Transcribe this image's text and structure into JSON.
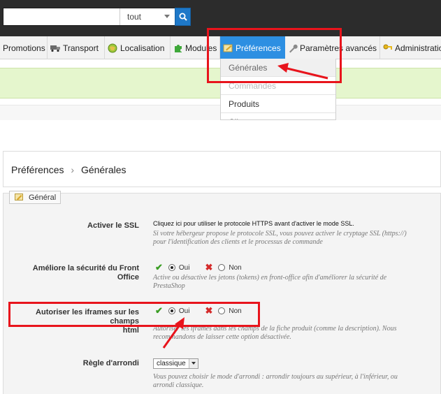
{
  "search": {
    "value": "",
    "scope": "tout"
  },
  "nav": {
    "items": [
      "Promotions",
      "Transport",
      "Localisation",
      "Modules",
      "Préférences",
      "Paramètres avancés",
      "Administration"
    ],
    "active_index": 4
  },
  "dropdown": {
    "items": [
      "Générales",
      "Commandes",
      "Produits",
      "Clients"
    ]
  },
  "breadcrumb": {
    "parent": "Préférences",
    "separator": "›",
    "current": "Générales"
  },
  "fieldset": {
    "legend": "Général"
  },
  "rows": {
    "ssl": {
      "label": "Activer le SSL",
      "link_text": "Cliquez ici pour utiliser le protocole HTTPS avant d'activer le mode SSL.",
      "hint_line1": "Si votre hébergeur propose le protocole SSL, vous pouvez activer le cryptage SSL (https://)",
      "hint_line2": "pour l'identification des clients et le processus de commande"
    },
    "security": {
      "label": "Améliore la sécurité du Front Office",
      "yes": "Oui",
      "no": "Non",
      "hint_line1": "Active ou désactive les jetons (tokens) en front-office afin d'améliorer la sécurité de",
      "hint_line2": "PrestaShop"
    },
    "iframes": {
      "label_line1": "Autoriser les iframes sur les champs",
      "label_line2": "html",
      "yes": "Oui",
      "no": "Non",
      "hint_line1": "Autoriser les iframes dans les champs de la fiche produit (comme la description). Nous",
      "hint_line2": "recommandons de laisser cette option désactivée."
    },
    "rounding": {
      "label": "Règle d'arrondi",
      "value": "classique",
      "hint_line1": "Vous pouvez choisir le mode d'arrondi : arrondir toujours au supérieur, à l'inférieur, ou",
      "hint_line2": "arrondi classique."
    }
  },
  "colors": {
    "highlight": "#e8141c",
    "active_tab": "#2d8fe2",
    "success_band": "#e5f6cd"
  }
}
